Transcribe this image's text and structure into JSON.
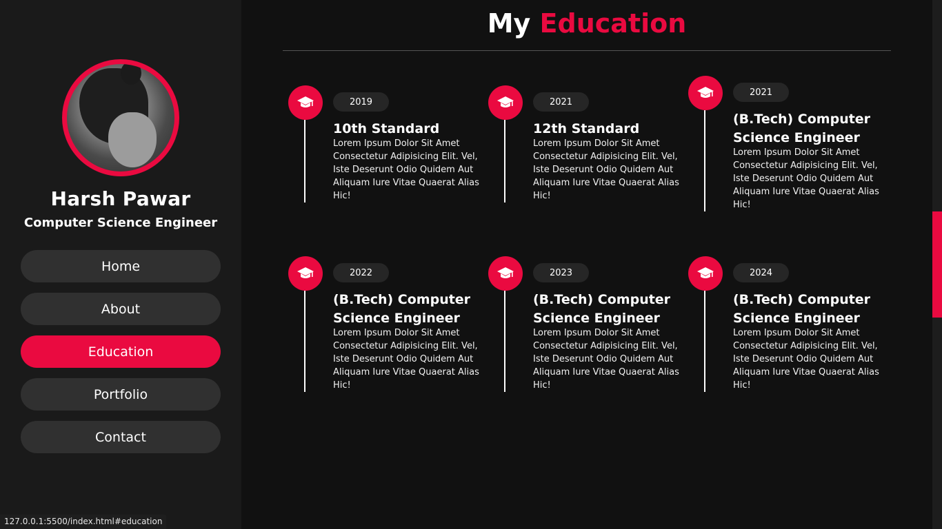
{
  "profile": {
    "name": "Harsh Pawar",
    "role": "Computer Science Engineer"
  },
  "nav": {
    "items": [
      {
        "label": "Home",
        "active": false
      },
      {
        "label": "About",
        "active": false
      },
      {
        "label": "Education",
        "active": true
      },
      {
        "label": "Portfolio",
        "active": false
      },
      {
        "label": "Contact",
        "active": false
      }
    ]
  },
  "section": {
    "title_main": "My",
    "title_accent": "Education"
  },
  "education": [
    {
      "year": "2019",
      "title": "10th Standard",
      "desc": "Lorem Ipsum Dolor Sit Amet Consectetur Adipisicing Elit. Vel, Iste Deserunt Odio Quidem Aut Aliquam Iure Vitae Quaerat Alias Hic!",
      "icon": "graduation-cap-icon"
    },
    {
      "year": "2021",
      "title": "12th Standard",
      "desc": "Lorem Ipsum Dolor Sit Amet Consectetur Adipisicing Elit. Vel, Iste Deserunt Odio Quidem Aut Aliquam Iure Vitae Quaerat Alias Hic!",
      "icon": "graduation-cap-icon"
    },
    {
      "year": "2021",
      "title": "(B.Tech) Computer Science Engineer",
      "desc": "Lorem Ipsum Dolor Sit Amet Consectetur Adipisicing Elit. Vel, Iste Deserunt Odio Quidem Aut Aliquam Iure Vitae Quaerat Alias Hic!",
      "icon": "graduation-cap-icon"
    },
    {
      "year": "2022",
      "title": "(B.Tech) Computer Science Engineer",
      "desc": "Lorem Ipsum Dolor Sit Amet Consectetur Adipisicing Elit. Vel, Iste Deserunt Odio Quidem Aut Aliquam Iure Vitae Quaerat Alias Hic!",
      "icon": "graduation-cap-icon"
    },
    {
      "year": "2023",
      "title": "(B.Tech) Computer Science Engineer",
      "desc": "Lorem Ipsum Dolor Sit Amet Consectetur Adipisicing Elit. Vel, Iste Deserunt Odio Quidem Aut Aliquam Iure Vitae Quaerat Alias Hic!",
      "icon": "graduation-cap-icon"
    },
    {
      "year": "2024",
      "title": "(B.Tech) Computer Science Engineer",
      "desc": "Lorem Ipsum Dolor Sit Amet Consectetur Adipisicing Elit. Vel, Iste Deserunt Odio Quidem Aut Aliquam Iure Vitae Quaerat Alias Hic!",
      "icon": "graduation-cap-icon"
    }
  ],
  "status_bar": {
    "url": "127.0.0.1:5500/index.html#education"
  },
  "colors": {
    "accent": "#ea0a40",
    "background": "#111111",
    "sidebar": "#1a1a1a",
    "nav_item": "#303030"
  }
}
